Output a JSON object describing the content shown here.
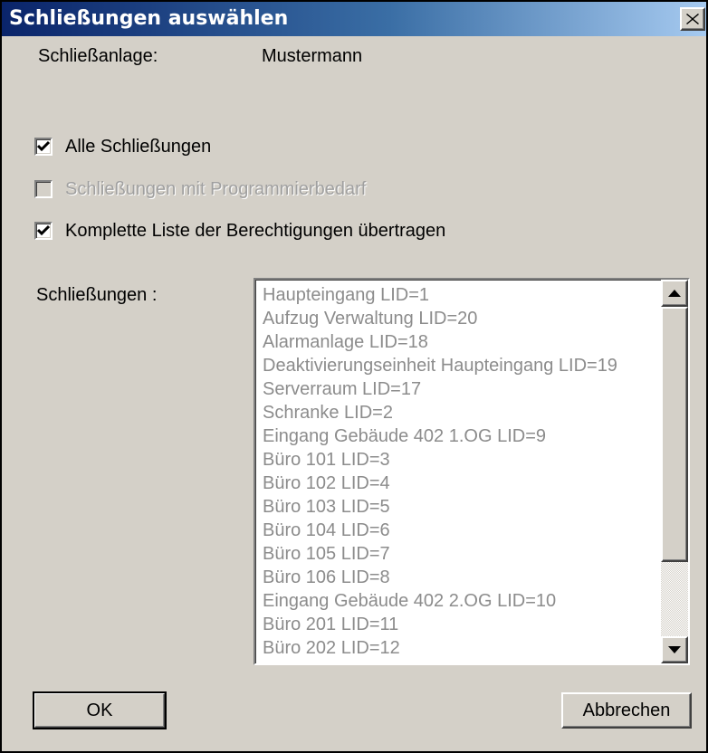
{
  "window": {
    "title": "Schließungen auswählen",
    "close_glyph": "✕"
  },
  "form": {
    "schliessanlage_label": "Schließanlage:",
    "schliessanlage_value": "Mustermann",
    "checkboxes": [
      {
        "label": "Alle Schließungen",
        "checked": true,
        "enabled": true
      },
      {
        "label": "Schließungen mit Programmierbedarf",
        "checked": false,
        "enabled": false
      },
      {
        "label": "Komplette Liste der Berechtigungen übertragen",
        "checked": true,
        "enabled": true
      }
    ],
    "list_label": "Schließungen :",
    "list_items": [
      "Haupteingang LID=1",
      "Aufzug Verwaltung LID=20",
      "Alarmanlage LID=18",
      "Deaktivierungseinheit Haupteingang LID=19",
      "Serverraum LID=17",
      "Schranke LID=2",
      "Eingang Gebäude 402 1.OG LID=9",
      "Büro 101 LID=3",
      "Büro 102 LID=4",
      "Büro 103 LID=5",
      "Büro 104 LID=6",
      "Büro 105 LID=7",
      "Büro 106 LID=8",
      "Eingang Gebäude 402 2.OG LID=10",
      "Büro 201 LID=11",
      "Büro 202 LID=12"
    ]
  },
  "buttons": {
    "ok_label": "OK",
    "cancel_label": "Abbrechen"
  },
  "colors": {
    "dialog_bg": "#d4d0c8",
    "title_start": "#0a246a",
    "title_end": "#a6caf0",
    "disabled_text": "#a0a0a0"
  },
  "icons": {
    "close": "close-icon",
    "check": "checkmark-icon",
    "scroll_up": "scroll-up-arrow-icon",
    "scroll_down": "scroll-down-arrow-icon"
  }
}
